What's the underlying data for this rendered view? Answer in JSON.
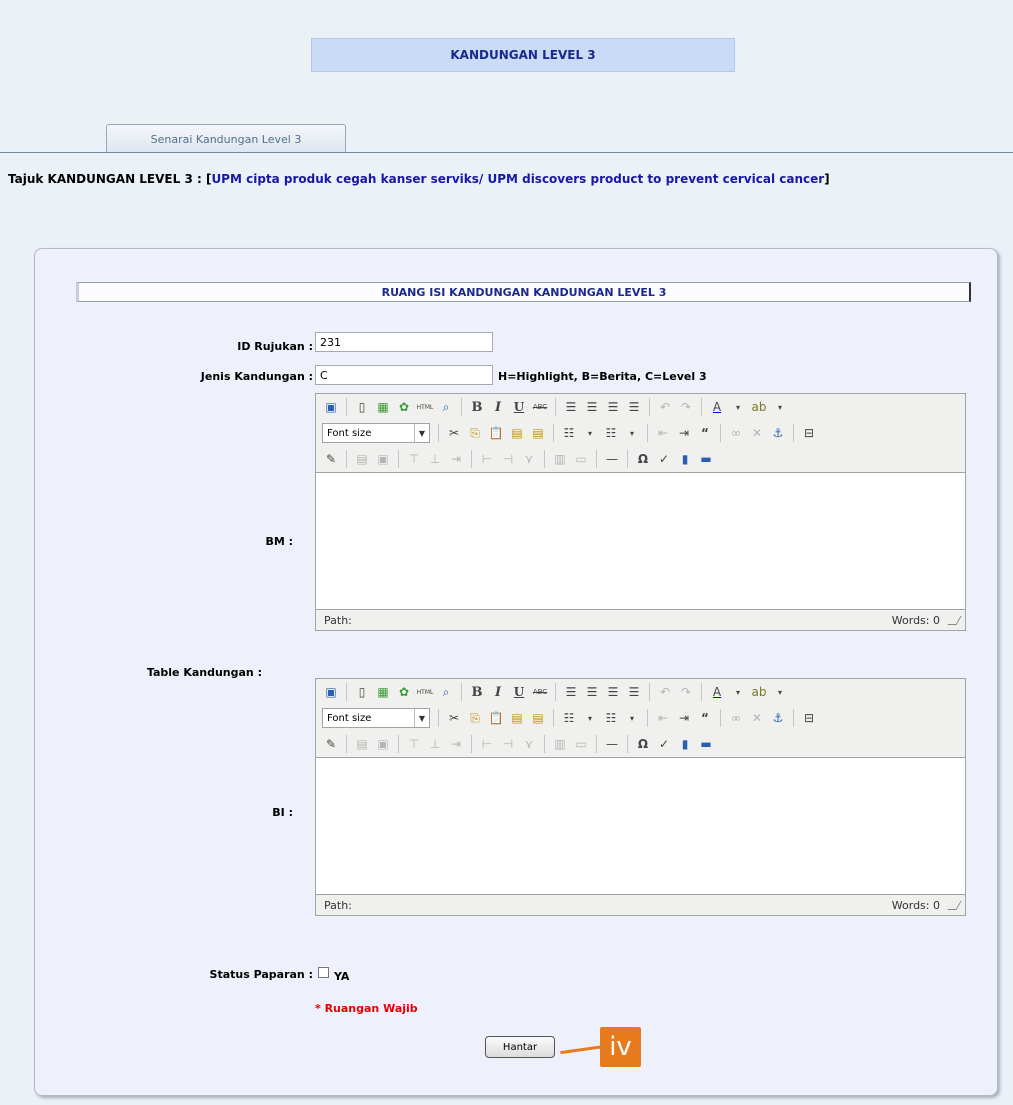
{
  "page": {
    "title": "KANDUNGAN LEVEL 3",
    "tab_label": "Senarai Kandungan Level 3",
    "tajuk_label": "Tajuk KANDUNGAN LEVEL 3 : [",
    "tajuk_link": "UPM cipta produk cegah kanser serviks/ UPM discovers product to prevent cervical cancer",
    "tajuk_close": "]"
  },
  "form": {
    "heading": "RUANG ISI KANDUNGAN KANDUNGAN LEVEL 3",
    "id_label": "ID Rujukan :",
    "id_value": "231",
    "jenis_label": "Jenis Kandungan :",
    "jenis_value": "C",
    "jenis_hint": "H=Highlight, B=Berita, C=Level 3",
    "table_label": "Table Kandungan :",
    "bm_label": "BM :",
    "bi_label": "BI :",
    "status_label": "Status Paparan :",
    "status_option": "YA",
    "required_note": "* Ruangan Wajib",
    "submit_label": "Hantar"
  },
  "editor": {
    "font_size_placeholder": "Font size",
    "path_label": "Path:",
    "words_label": "Words: 0"
  },
  "callout": {
    "label": "iv"
  },
  "colors": {
    "callout": "#e87a1e",
    "required": "#e60000",
    "heading_text": "#1a2a8c",
    "link": "#1717a9"
  }
}
